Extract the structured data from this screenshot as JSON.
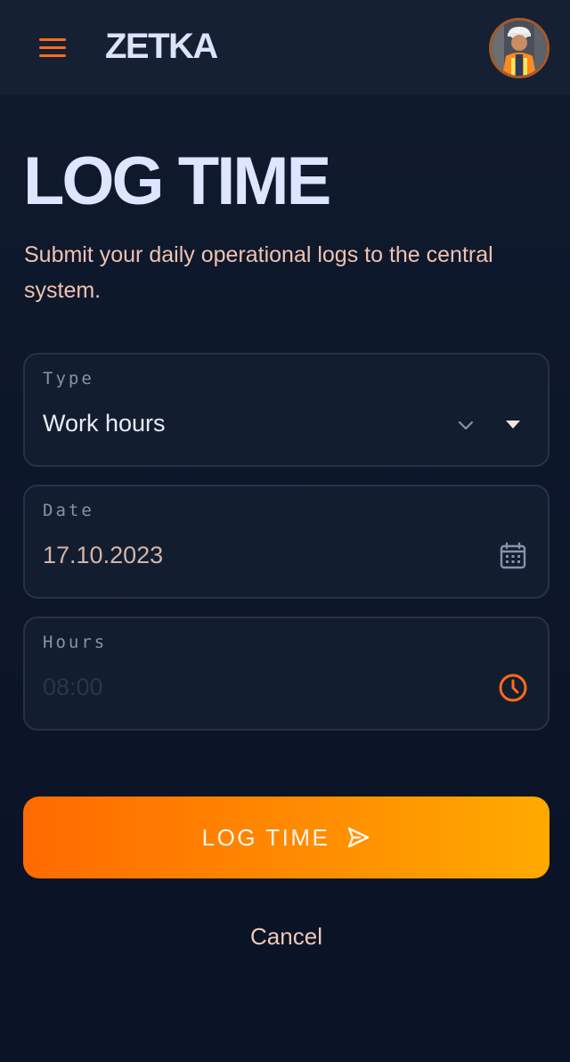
{
  "app": {
    "brand": "ZETKA"
  },
  "header": {
    "menu_icon": "hamburger-menu-icon",
    "avatar_alt": "user avatar"
  },
  "page": {
    "title": "LOG TIME",
    "subtitle": "Submit your daily operational logs to the central system."
  },
  "form": {
    "type": {
      "label": "Type",
      "value": "Work hours",
      "icon": "chevron-down-icon"
    },
    "date": {
      "label": "Date",
      "value": "17.10.2023",
      "icon": "calendar-icon"
    },
    "hours": {
      "label": "Hours",
      "placeholder": "08:00",
      "icon": "clock-icon"
    }
  },
  "actions": {
    "submit_label": "LOG TIME",
    "submit_icon": "send-icon",
    "cancel_label": "Cancel"
  },
  "colors": {
    "accent": "#ff6b1a",
    "background": "#0b1426",
    "surface": "#131d30",
    "title": "#dde5ff",
    "subtitle": "#f0c2b0"
  }
}
